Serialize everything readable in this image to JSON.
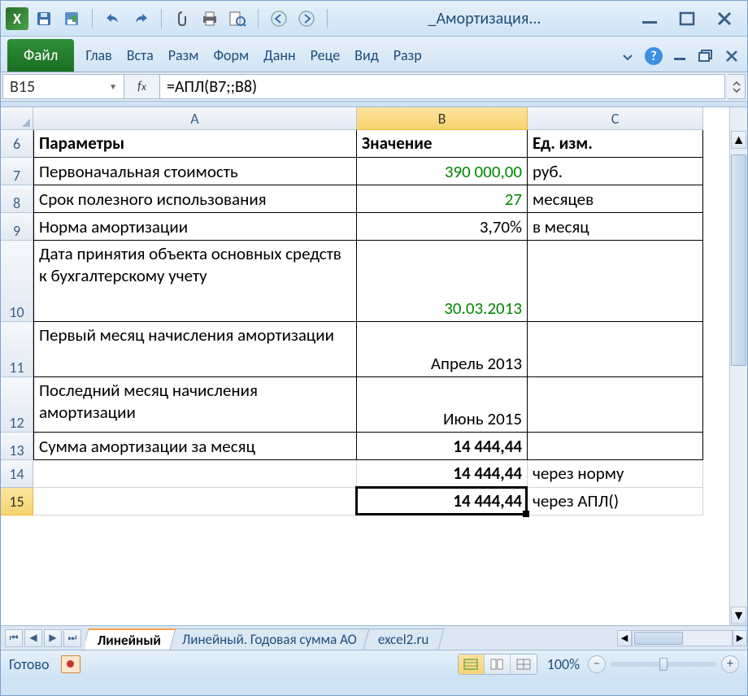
{
  "title": "_Амортизация...",
  "ribbon": {
    "file": "Файл",
    "tabs": [
      "Глав",
      "Вста",
      "Разм",
      "Форм",
      "Данн",
      "Реце",
      "Вид",
      "Разр"
    ]
  },
  "nameBox": "B15",
  "formula": "=АПЛ(B7;;B8)",
  "columns": [
    "A",
    "B",
    "C"
  ],
  "rowHeaders": [
    "6",
    "7",
    "8",
    "9",
    "10",
    "11",
    "12",
    "13",
    "14",
    "15"
  ],
  "table": {
    "header": {
      "a": "Параметры",
      "b": "Значение",
      "c": "Ед. изм."
    },
    "rows": [
      {
        "n": "7",
        "a": "Первоначальная стоимость",
        "b": "390 000,00",
        "c": "руб.",
        "green": true,
        "h": 34
      },
      {
        "n": "8",
        "a": "Срок полезного использования",
        "b": "27",
        "c": "месяцев",
        "green": true,
        "h": 34
      },
      {
        "n": "9",
        "a": "Норма амортизации",
        "b": "3,70%",
        "c": "в месяц",
        "h": 34
      },
      {
        "n": "10",
        "a": "Дата принятия объекта основных средств к бухгалтерскому учету",
        "b": "30.03.2013",
        "c": "",
        "green": true,
        "h": 100,
        "multi": true
      },
      {
        "n": "11",
        "a": "Первый месяц начисления амортизации",
        "b": "Апрель 2013",
        "c": "",
        "h": 68,
        "multi": true
      },
      {
        "n": "12",
        "a": "Последний месяц начисления амортизации",
        "b": "Июнь 2015",
        "c": "",
        "h": 68,
        "multi": true
      },
      {
        "n": "13",
        "a": "Сумма амортизации за месяц",
        "b": "14 444,44",
        "c": "",
        "bold": true,
        "h": 34
      }
    ],
    "extra": [
      {
        "n": "14",
        "b": "14 444,44",
        "c": "через норму"
      },
      {
        "n": "15",
        "b": "14 444,44",
        "c": "через АПЛ()"
      }
    ]
  },
  "sheets": {
    "active": "Линейный",
    "others": [
      "Линейный. Годовая сумма АО",
      "excel2.ru"
    ]
  },
  "status": {
    "ready": "Готово",
    "zoom": "100%"
  }
}
